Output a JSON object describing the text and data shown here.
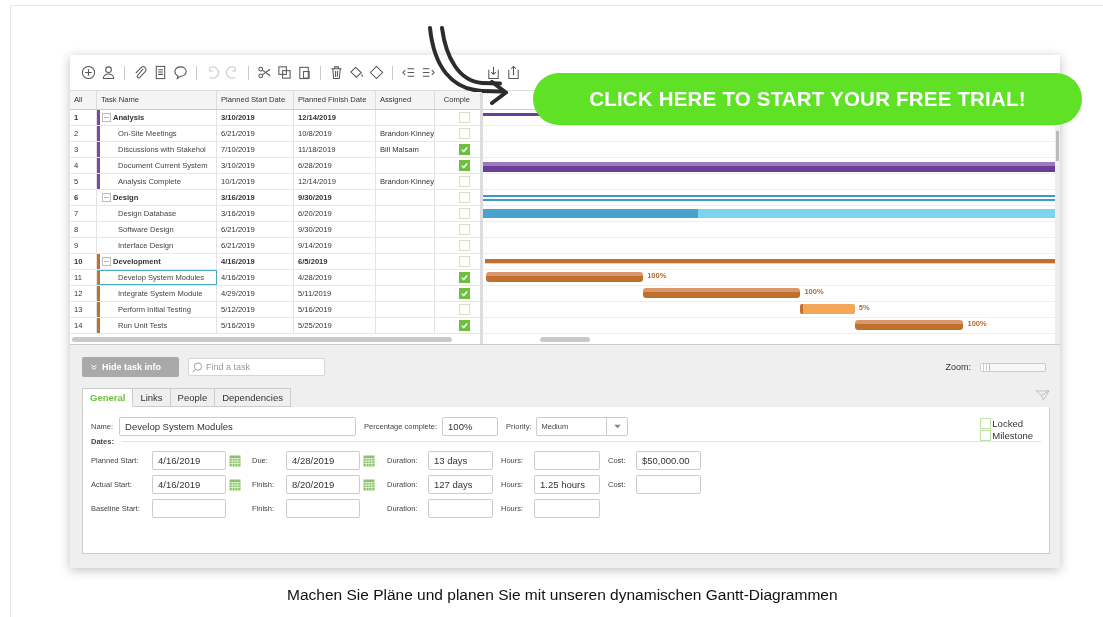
{
  "grid": {
    "columns": [
      "All",
      "Task Name",
      "Planned Start Date",
      "Planned Finish Date",
      "Assigned",
      "Comple"
    ],
    "rows": [
      {
        "num": "1",
        "kind": "group",
        "expanded": true,
        "name": "Analysis",
        "start": "3/10/2019",
        "finish": "12/14/2019",
        "complete": false,
        "selected": false,
        "color": "#7b4aa0"
      },
      {
        "num": "2",
        "kind": "task",
        "name": "On-Site Meetings",
        "start": "6/21/2019",
        "finish": "10/8/2019",
        "assigned": "Brandon Kinney",
        "complete": false,
        "selected": false,
        "color": "#7b4aa0"
      },
      {
        "num": "3",
        "kind": "task",
        "name": "Discussions with Stakehol",
        "start": "7/10/2019",
        "finish": "11/18/2019",
        "assigned": "Bill Malsam",
        "complete": true,
        "selected": false,
        "color": "#7b4aa0"
      },
      {
        "num": "4",
        "kind": "task",
        "name": "Document Current System",
        "start": "3/10/2019",
        "finish": "6/28/2019",
        "complete": true,
        "selected": false,
        "color": "#7b4aa0"
      },
      {
        "num": "5",
        "kind": "task",
        "name": "Analysis Complete",
        "start": "10/1/2019",
        "finish": "12/14/2019",
        "assigned": "Brandon Kinney",
        "complete": false,
        "selected": false,
        "color": "#7b4aa0"
      },
      {
        "num": "6",
        "kind": "group",
        "expanded": true,
        "name": "Design",
        "start": "3/16/2019",
        "finish": "9/30/2019",
        "complete": false,
        "selected": false
      },
      {
        "num": "7",
        "kind": "task",
        "name": "Design Database",
        "start": "3/16/2019",
        "finish": "6/20/2019",
        "complete": false,
        "selected": false
      },
      {
        "num": "8",
        "kind": "task",
        "name": "Software Design",
        "start": "6/21/2019",
        "finish": "9/30/2019",
        "complete": false,
        "selected": false
      },
      {
        "num": "9",
        "kind": "task",
        "name": "Interface Design",
        "start": "6/21/2019",
        "finish": "9/14/2019",
        "complete": false,
        "selected": false
      },
      {
        "num": "10",
        "kind": "group",
        "expanded": true,
        "name": "Development",
        "start": "4/16/2019",
        "finish": "6/5/2019",
        "complete": false,
        "selected": false,
        "color": "#c0702e"
      },
      {
        "num": "11",
        "kind": "task",
        "name": "Develop System Modules",
        "start": "4/16/2019",
        "finish": "4/28/2019",
        "complete": true,
        "selected": true,
        "color": "#c0702e",
        "bar_label": "100%"
      },
      {
        "num": "12",
        "kind": "task",
        "name": "Integrate System Module",
        "start": "4/29/2019",
        "finish": "5/11/2019",
        "complete": true,
        "selected": false,
        "color": "#c0702e",
        "bar_label": "100%"
      },
      {
        "num": "13",
        "kind": "task",
        "name": "Perform Initial Testing",
        "start": "5/12/2019",
        "finish": "5/16/2019",
        "complete": false,
        "selected": false,
        "color": "#c0702e",
        "bar_label": "5%"
      },
      {
        "num": "14",
        "kind": "task",
        "name": "Run Unit Tests",
        "start": "5/16/2019",
        "finish": "5/25/2019",
        "complete": true,
        "selected": false,
        "color": "#c0702e",
        "bar_label": "100%"
      }
    ]
  },
  "cta": "CLICK HERE TO START YOUR FREE TRIAL!",
  "hide_button": "Hide task info",
  "search": {
    "placeholder": "Find a task"
  },
  "zoom": {
    "label": "Zoom:",
    "level": 0.1
  },
  "tabs": [
    {
      "label": "General",
      "selected": true
    },
    {
      "label": "Links",
      "selected": false
    },
    {
      "label": "People",
      "selected": false
    },
    {
      "label": "Dependencies",
      "selected": false
    }
  ],
  "details": {
    "name": {
      "label": "Name:",
      "value": "Develop System Modules"
    },
    "percentage": {
      "label": "Percentage complete:",
      "value": "100%"
    },
    "priority": {
      "label": "Priority:",
      "value": "Medium"
    },
    "flags": [
      {
        "label": "Locked",
        "checked": false
      },
      {
        "label": "Milestone",
        "checked": false
      }
    ],
    "dates_label": "Dates:",
    "date_rows": [
      [
        {
          "label": "Planned Start:",
          "value": "4/16/2019",
          "calendar": true
        },
        {
          "label": "Due:",
          "value": "4/28/2019",
          "calendar": true
        },
        {
          "label": "Duration:",
          "value": "13 days"
        },
        {
          "label": "Hours:"
        },
        {
          "label": "Cost:",
          "value": "$50,000.00"
        }
      ],
      [
        {
          "label": "Actual Start:",
          "value": "4/16/2019",
          "calendar": true
        },
        {
          "label": "Finish:",
          "value": "8/20/2019",
          "calendar": true
        },
        {
          "label": "Duration:",
          "value": "127 days"
        },
        {
          "label": "Hours:",
          "value": "1.25 hours"
        },
        {
          "label": "Cost:"
        }
      ],
      [
        {
          "label": "Baseline Start:"
        },
        {
          "label": "Finish:"
        },
        {
          "label": "Duration:"
        },
        {
          "label": "Hours:"
        }
      ]
    ]
  },
  "caption": "Machen Sie Pläne und planen Sie mit unseren dynamischen Gantt-Diagrammen"
}
